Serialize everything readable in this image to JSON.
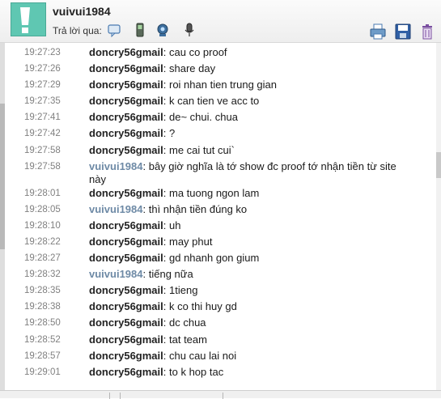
{
  "header": {
    "contact_name": "vuivui1984",
    "reply_via_label": "Trả lời qua:",
    "reply_icons": [
      "im-bubble-icon",
      "mobile-phone-icon",
      "webcam-icon",
      "microphone-icon"
    ],
    "toolbar_icons": [
      "print-icon",
      "save-icon",
      "delete-icon"
    ],
    "avatar_color": "#5fc7b2"
  },
  "colors": {
    "other_sender": "#222222",
    "self_sender": "#6e8aa6",
    "timestamp": "#808080"
  },
  "messages": [
    {
      "time": "19:27:23",
      "sender": "doncry56gmail",
      "text": "cau co proof",
      "self": false
    },
    {
      "time": "19:27:26",
      "sender": "doncry56gmail",
      "text": "share day",
      "self": false
    },
    {
      "time": "19:27:29",
      "sender": "doncry56gmail",
      "text": "roi nhan tien trung gian",
      "self": false
    },
    {
      "time": "19:27:35",
      "sender": "doncry56gmail",
      "text": "k can tien ve acc to",
      "self": false
    },
    {
      "time": "19:27:41",
      "sender": "doncry56gmail",
      "text": "de~ chui. chua",
      "self": false
    },
    {
      "time": "19:27:42",
      "sender": "doncry56gmail",
      "text": "?",
      "self": false
    },
    {
      "time": "19:27:58",
      "sender": "doncry56gmail",
      "text": "me cai tut cui`",
      "self": false
    },
    {
      "time": "19:27:58",
      "sender": "vuivui1984",
      "text": "bây giờ nghĩa là tớ show đc proof tớ nhận tiền từ site này",
      "self": true
    },
    {
      "time": "19:28:01",
      "sender": "doncry56gmail",
      "text": "ma tuong ngon lam",
      "self": false
    },
    {
      "time": "19:28:05",
      "sender": "vuivui1984",
      "text": "thì nhận tiền đúng ko",
      "self": true
    },
    {
      "time": "19:28:10",
      "sender": "doncry56gmail",
      "text": "uh",
      "self": false
    },
    {
      "time": "19:28:22",
      "sender": "doncry56gmail",
      "text": "may phut",
      "self": false
    },
    {
      "time": "19:28:27",
      "sender": "doncry56gmail",
      "text": "gd nhanh gon gium",
      "self": false
    },
    {
      "time": "19:28:32",
      "sender": "vuivui1984",
      "text": "tiếng nữa",
      "self": true
    },
    {
      "time": "19:28:35",
      "sender": "doncry56gmail",
      "text": "1tieng",
      "self": false
    },
    {
      "time": "19:28:38",
      "sender": "doncry56gmail",
      "text": "k co thi huy gd",
      "self": false
    },
    {
      "time": "19:28:50",
      "sender": "doncry56gmail",
      "text": "dc chua",
      "self": false
    },
    {
      "time": "19:28:52",
      "sender": "doncry56gmail",
      "text": "tat team",
      "self": false
    },
    {
      "time": "19:28:57",
      "sender": "doncry56gmail",
      "text": "chu cau lai noi",
      "self": false
    },
    {
      "time": "19:29:01",
      "sender": "doncry56gmail",
      "text": "to k hop tac",
      "self": false
    }
  ]
}
